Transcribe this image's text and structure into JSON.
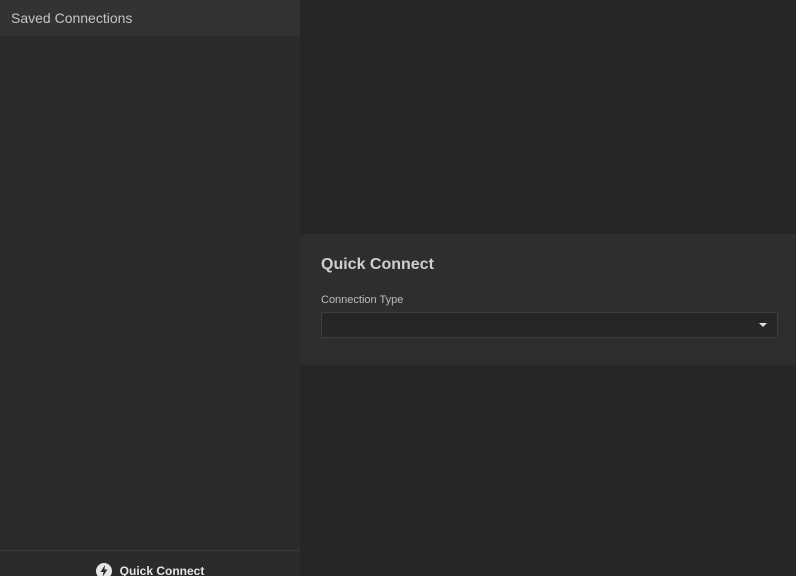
{
  "sidebar": {
    "header_title": "Saved Connections",
    "footer_button_label": "Quick Connect"
  },
  "quick_connect": {
    "title": "Quick Connect",
    "connection_type_label": "Connection Type",
    "connection_type_value": ""
  },
  "icons": {
    "quick_connect": "lightning-bolt-icon",
    "dropdown": "chevron-down-icon"
  },
  "colors": {
    "background": "#262626",
    "sidebar": "#2b2b2b",
    "sidebar_header": "#333333",
    "card": "#2e2e2e",
    "text": "#c8c8c8"
  }
}
